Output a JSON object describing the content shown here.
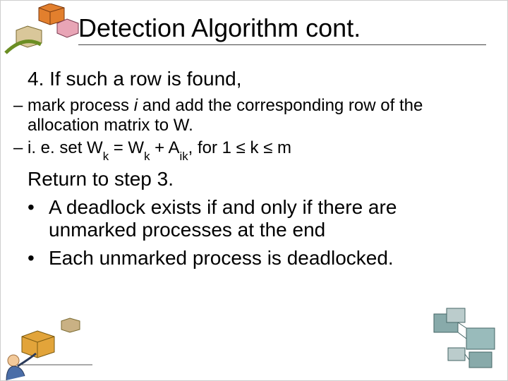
{
  "title": "Detection Algorithm cont.",
  "step4": {
    "header": "4. If such a row is found,",
    "sub1": "mark process ",
    "sub1_i": "i",
    "sub1_rest": " and add the corresponding row of the allocation matrix to W.",
    "sub2_prefix": "i. e.  set W",
    "sub2_k1": "k",
    "sub2_mid": " = W",
    "sub2_k2": "k",
    "sub2_plus": " + A",
    "sub2_ik": "ik",
    "sub2_rest": ", for 1 ≤ k ≤ m"
  },
  "return_line": "Return to step 3.",
  "bullets": {
    "b1": "A deadlock exists if and only if there are unmarked processes at the end",
    "b2": " Each unmarked process is deadlocked."
  }
}
